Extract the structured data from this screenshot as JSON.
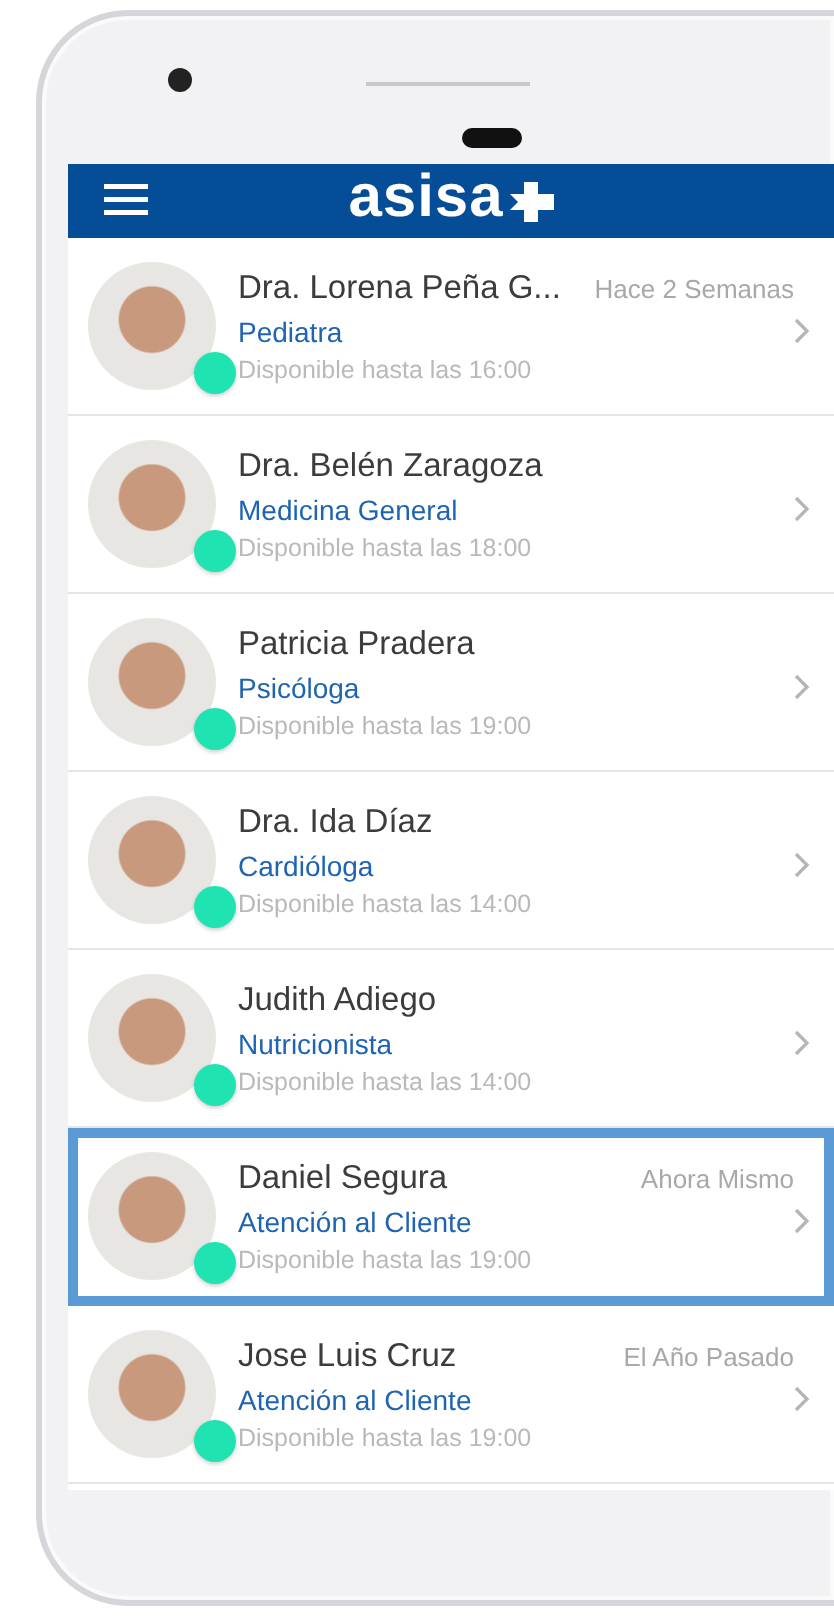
{
  "header": {
    "logo": "asisa"
  },
  "contacts": [
    {
      "name": "Dra. Lorena Peña G...",
      "time": "Hace 2 Semanas",
      "specialty": "Pediatra",
      "availability": "Disponible hasta las 16:00",
      "selected": false
    },
    {
      "name": "Dra. Belén Zaragoza",
      "specialty": "Medicina General",
      "availability": "Disponible hasta las 18:00",
      "selected": false
    },
    {
      "name": "Patricia Pradera",
      "specialty": "Psicóloga",
      "availability": "Disponible hasta las 19:00",
      "selected": false
    },
    {
      "name": "Dra. Ida Díaz",
      "specialty": "Cardióloga",
      "availability": "Disponible hasta las 14:00",
      "selected": false
    },
    {
      "name": "Judith Adiego",
      "specialty": "Nutricionista",
      "availability": "Disponible hasta las 14:00",
      "selected": false
    },
    {
      "name": "Daniel Segura",
      "time": "Ahora Mismo",
      "specialty": "Atención al Cliente",
      "availability": "Disponible hasta las 19:00",
      "selected": true
    },
    {
      "name": "Jose Luis Cruz",
      "time": "El Año Pasado",
      "specialty": "Atención al Cliente",
      "availability": "Disponible hasta las 19:00",
      "selected": false
    }
  ]
}
